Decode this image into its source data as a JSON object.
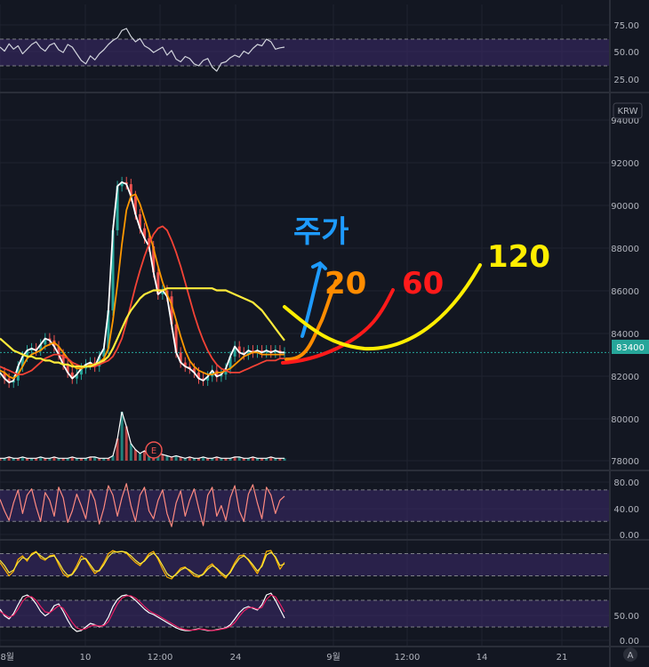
{
  "colors": {
    "background": "#131722",
    "price_up": "#26a69a",
    "price_down": "#ef5350",
    "ma_price": "#ffffff",
    "ma20": "#ff9800",
    "ma60": "#f44336",
    "ma120": "#ffeb3b",
    "annotation_price": "#1e9bff",
    "annotation_20": "#ff8c00",
    "annotation_60": "#ff1a1a",
    "annotation_120": "#ffee00",
    "band": "#3c2a6b",
    "last_price": "#26a69a"
  },
  "currency_badge": "KRW",
  "last_price_label": "83400",
  "event_marker": "E",
  "autoscale_button": "A",
  "x_axis_labels": [
    "10",
    "12:00",
    "24",
    "9월",
    "12:00",
    "14",
    "21"
  ],
  "x_axis_label_partial": "8월",
  "annotations": {
    "price": "주가",
    "ma20": "20",
    "ma60": "60",
    "ma120": "120"
  },
  "chart_data": [
    {
      "type": "line",
      "title": "",
      "ylabel": "",
      "ylim": [
        10,
        90
      ],
      "yticks": [
        "75.00",
        "50.00",
        "25.00"
      ],
      "band": [
        30,
        70
      ],
      "x": [
        0,
        5,
        10,
        15,
        20,
        25,
        30,
        35,
        40,
        45,
        50,
        55,
        60,
        65,
        70,
        75,
        80,
        85,
        90,
        95,
        100,
        105,
        110,
        115,
        120,
        125,
        130,
        135,
        140,
        145,
        150,
        155,
        160,
        165,
        170,
        175,
        180,
        185,
        190,
        195,
        200,
        205,
        210,
        215,
        220,
        225,
        230,
        235,
        240,
        245,
        250,
        255,
        260,
        265,
        270,
        275,
        280,
        285,
        290,
        295,
        300,
        305,
        310,
        315
      ],
      "series": [
        {
          "name": "",
          "values": [
            58,
            52,
            63,
            55,
            60,
            48,
            55,
            62,
            66,
            57,
            52,
            61,
            64,
            54,
            50,
            62,
            58,
            48,
            38,
            33,
            45,
            39,
            48,
            54,
            62,
            68,
            72,
            83,
            86,
            74,
            66,
            71,
            60,
            56,
            50,
            54,
            58,
            46,
            53,
            40,
            36,
            44,
            41,
            33,
            30,
            38,
            41,
            28,
            22,
            34,
            36,
            42,
            46,
            43,
            52,
            48,
            56,
            62,
            60,
            70,
            66,
            55,
            57,
            58
          ]
        }
      ]
    },
    {
      "type": "line",
      "title": "",
      "ylabel": "",
      "ylim": [
        78000,
        95000
      ],
      "yticks": [
        "94000",
        "92000",
        "90000",
        "88000",
        "86000",
        "84000",
        "82000",
        "80000",
        "78000"
      ],
      "last_price": 83400,
      "x": [
        0,
        5,
        10,
        15,
        20,
        25,
        30,
        35,
        40,
        45,
        50,
        55,
        60,
        65,
        70,
        75,
        80,
        85,
        90,
        95,
        100,
        105,
        110,
        115,
        120,
        125,
        130,
        135,
        140,
        145,
        150,
        155,
        160,
        165,
        170,
        175,
        180,
        185,
        190,
        195,
        200,
        205,
        210,
        215,
        220,
        225,
        230,
        235,
        240,
        245,
        250,
        255,
        260,
        265,
        270,
        275,
        280,
        285,
        290,
        295,
        300,
        305,
        310,
        315
      ],
      "series": [
        {
          "name": "",
          "values": [
            82400,
            82100,
            81900,
            82000,
            82700,
            83200,
            83500,
            83600,
            83500,
            83800,
            84100,
            84000,
            83700,
            83300,
            82800,
            82400,
            82100,
            82300,
            82600,
            82800,
            82900,
            82700,
            83200,
            83600,
            85500,
            89500,
            91700,
            91900,
            91800,
            91200,
            90300,
            89600,
            89100,
            88700,
            87400,
            86300,
            86500,
            86200,
            84800,
            83400,
            82900,
            82700,
            82600,
            82400,
            82100,
            82000,
            82200,
            82500,
            82200,
            82300,
            82600,
            83200,
            83700,
            83400,
            83300,
            83500,
            83400,
            83500,
            83400,
            83500,
            83400,
            83500,
            83400,
            83400
          ]
        },
        {
          "name": "",
          "values": [
            82500,
            82400,
            82200,
            82100,
            82300,
            82700,
            83100,
            83300,
            83400,
            83500,
            83700,
            83800,
            83900,
            83700,
            83400,
            83100,
            82800,
            82600,
            82600,
            82700,
            82800,
            82800,
            82900,
            83100,
            83600,
            85000,
            86800,
            88800,
            90500,
            91200,
            91300,
            90800,
            90100,
            89400,
            88600,
            87700,
            86900,
            86300,
            85800,
            85000,
            84200,
            83500,
            83000,
            82700,
            82500,
            82400,
            82300,
            82300,
            82400,
            82400,
            82500,
            82600,
            82800,
            83000,
            83200,
            83300,
            83400,
            83400,
            83300,
            83300,
            83300,
            83300,
            83300,
            83300
          ]
        },
        {
          "name": "",
          "values": [
            82700,
            82600,
            82500,
            82400,
            82300,
            82300,
            82400,
            82500,
            82700,
            82900,
            83100,
            83200,
            83300,
            83300,
            83200,
            83100,
            82900,
            82800,
            82700,
            82700,
            82700,
            82700,
            82800,
            82900,
            83000,
            83200,
            83600,
            84100,
            84900,
            85800,
            86700,
            87500,
            88200,
            88800,
            89300,
            89600,
            89700,
            89500,
            89000,
            88400,
            87700,
            86900,
            86100,
            85300,
            84600,
            84000,
            83500,
            83100,
            82800,
            82600,
            82500,
            82400,
            82400,
            82400,
            82500,
            82600,
            82700,
            82800,
            82900,
            83000,
            83000,
            83000,
            83100,
            83100
          ]
        },
        {
          "name": "",
          "values": [
            84100,
            83900,
            83700,
            83500,
            83400,
            83300,
            83200,
            83200,
            83100,
            83100,
            83000,
            83000,
            82900,
            82900,
            82800,
            82800,
            82700,
            82700,
            82700,
            82700,
            82700,
            82800,
            82900,
            83000,
            83200,
            83600,
            84100,
            84600,
            85100,
            85500,
            85800,
            86100,
            86300,
            86400,
            86500,
            86500,
            86500,
            86600,
            86600,
            86600,
            86600,
            86600,
            86600,
            86600,
            86600,
            86600,
            86600,
            86600,
            86500,
            86500,
            86500,
            86400,
            86300,
            86200,
            86100,
            86000,
            85900,
            85700,
            85500,
            85200,
            84900,
            84600,
            84300,
            84000
          ]
        }
      ],
      "volume": [
        2,
        2,
        3,
        2,
        2,
        3,
        2,
        2,
        2,
        3,
        2,
        2,
        3,
        2,
        2,
        2,
        3,
        2,
        2,
        2,
        3,
        3,
        2,
        2,
        2,
        4,
        18,
        40,
        28,
        14,
        9,
        6,
        8,
        5,
        4,
        6,
        5,
        4,
        3,
        4,
        3,
        2,
        3,
        2,
        2,
        3,
        2,
        2,
        3,
        2,
        2,
        2,
        3,
        3,
        2,
        2,
        3,
        2,
        2,
        2,
        3,
        2,
        2,
        2
      ]
    },
    {
      "type": "line",
      "title": "",
      "ylabel": "",
      "ylim": [
        -5,
        95
      ],
      "yticks": [
        "80.00",
        "40.00",
        "0.00"
      ],
      "band": [
        20,
        80
      ],
      "x": [
        0,
        5,
        10,
        15,
        20,
        25,
        30,
        35,
        40,
        45,
        50,
        55,
        60,
        65,
        70,
        75,
        80,
        85,
        90,
        95,
        100,
        105,
        110,
        115,
        120,
        125,
        130,
        135,
        140,
        145,
        150,
        155,
        160,
        165,
        170,
        175,
        180,
        185,
        190,
        195,
        200,
        205,
        210,
        215,
        220,
        225,
        230,
        235,
        240,
        245,
        250,
        255,
        260,
        265,
        270,
        275,
        280,
        285,
        290,
        295,
        300,
        305,
        310,
        315
      ],
      "series": [
        {
          "name": "",
          "values": [
            62,
            40,
            22,
            55,
            80,
            35,
            70,
            82,
            48,
            20,
            75,
            60,
            30,
            85,
            65,
            18,
            40,
            72,
            50,
            25,
            80,
            60,
            15,
            45,
            88,
            70,
            30,
            65,
            92,
            50,
            20,
            70,
            85,
            40,
            25,
            60,
            80,
            35,
            10,
            55,
            78,
            30,
            60,
            82,
            45,
            12,
            70,
            85,
            30,
            50,
            22,
            65,
            88,
            40,
            20,
            72,
            90,
            55,
            25,
            85,
            70,
            35,
            60,
            68
          ]
        }
      ]
    },
    {
      "type": "line",
      "title": "",
      "ylabel": "",
      "ylim": [
        0,
        100
      ],
      "yticks": [],
      "band": [
        25,
        75
      ],
      "x": [
        0,
        5,
        10,
        15,
        20,
        25,
        30,
        35,
        40,
        45,
        50,
        55,
        60,
        65,
        70,
        75,
        80,
        85,
        90,
        95,
        100,
        105,
        110,
        115,
        120,
        125,
        130,
        135,
        140,
        145,
        150,
        155,
        160,
        165,
        170,
        175,
        180,
        185,
        190,
        195,
        200,
        205,
        210,
        215,
        220,
        225,
        230,
        235,
        240,
        245,
        250,
        255,
        260,
        265,
        270,
        275,
        280,
        285,
        290,
        295,
        300,
        305,
        310,
        315
      ],
      "series": [
        {
          "name": "",
          "values": [
            55,
            40,
            25,
            35,
            62,
            70,
            58,
            75,
            80,
            65,
            60,
            70,
            72,
            50,
            30,
            22,
            30,
            48,
            70,
            62,
            45,
            30,
            38,
            55,
            75,
            82,
            78,
            80,
            76,
            65,
            55,
            48,
            60,
            75,
            80,
            62,
            40,
            22,
            18,
            30,
            42,
            45,
            35,
            25,
            22,
            30,
            45,
            52,
            40,
            28,
            20,
            35,
            55,
            70,
            72,
            60,
            45,
            30,
            50,
            80,
            82,
            65,
            40,
            55
          ]
        },
        {
          "name": "",
          "values": [
            60,
            48,
            32,
            38,
            55,
            66,
            62,
            72,
            78,
            70,
            63,
            68,
            70,
            56,
            38,
            26,
            28,
            42,
            62,
            64,
            50,
            36,
            36,
            50,
            68,
            78,
            79,
            80,
            78,
            70,
            60,
            52,
            58,
            70,
            76,
            66,
            48,
            30,
            22,
            28,
            38,
            43,
            38,
            30,
            25,
            28,
            40,
            48,
            42,
            32,
            24,
            32,
            50,
            64,
            70,
            62,
            50,
            36,
            46,
            72,
            78,
            68,
            48,
            52
          ]
        }
      ]
    },
    {
      "type": "line",
      "title": "",
      "ylabel": "",
      "ylim": [
        -10,
        100
      ],
      "yticks": [
        "50.00",
        "0.00"
      ],
      "band": [
        20,
        80
      ],
      "x": [
        0,
        5,
        10,
        15,
        20,
        25,
        30,
        35,
        40,
        45,
        50,
        55,
        60,
        65,
        70,
        75,
        80,
        85,
        90,
        95,
        100,
        105,
        110,
        115,
        120,
        125,
        130,
        135,
        140,
        145,
        150,
        155,
        160,
        165,
        170,
        175,
        180,
        185,
        190,
        195,
        200,
        205,
        210,
        215,
        220,
        225,
        230,
        235,
        240,
        245,
        250,
        255,
        260,
        265,
        270,
        275,
        280,
        285,
        290,
        295,
        300,
        305,
        310,
        315
      ],
      "series": [
        {
          "name": "",
          "values": [
            60,
            45,
            38,
            50,
            70,
            88,
            92,
            85,
            72,
            55,
            45,
            52,
            68,
            72,
            55,
            35,
            18,
            10,
            12,
            20,
            28,
            25,
            20,
            25,
            42,
            66,
            82,
            90,
            92,
            88,
            80,
            70,
            60,
            52,
            48,
            42,
            36,
            30,
            24,
            18,
            14,
            12,
            12,
            14,
            16,
            14,
            12,
            12,
            14,
            16,
            18,
            25,
            38,
            52,
            62,
            66,
            62,
            58,
            70,
            92,
            96,
            80,
            60,
            40
          ]
        },
        {
          "name": "",
          "values": [
            55,
            48,
            42,
            46,
            60,
            78,
            88,
            88,
            80,
            66,
            54,
            52,
            60,
            68,
            62,
            46,
            30,
            18,
            14,
            16,
            22,
            24,
            22,
            23,
            32,
            52,
            72,
            85,
            90,
            90,
            85,
            76,
            66,
            57,
            51,
            46,
            40,
            34,
            28,
            22,
            17,
            14,
            13,
            13,
            15,
            15,
            13,
            12,
            13,
            15,
            17,
            21,
            30,
            44,
            56,
            63,
            64,
            60,
            64,
            82,
            92,
            88,
            72,
            54
          ]
        }
      ]
    }
  ]
}
